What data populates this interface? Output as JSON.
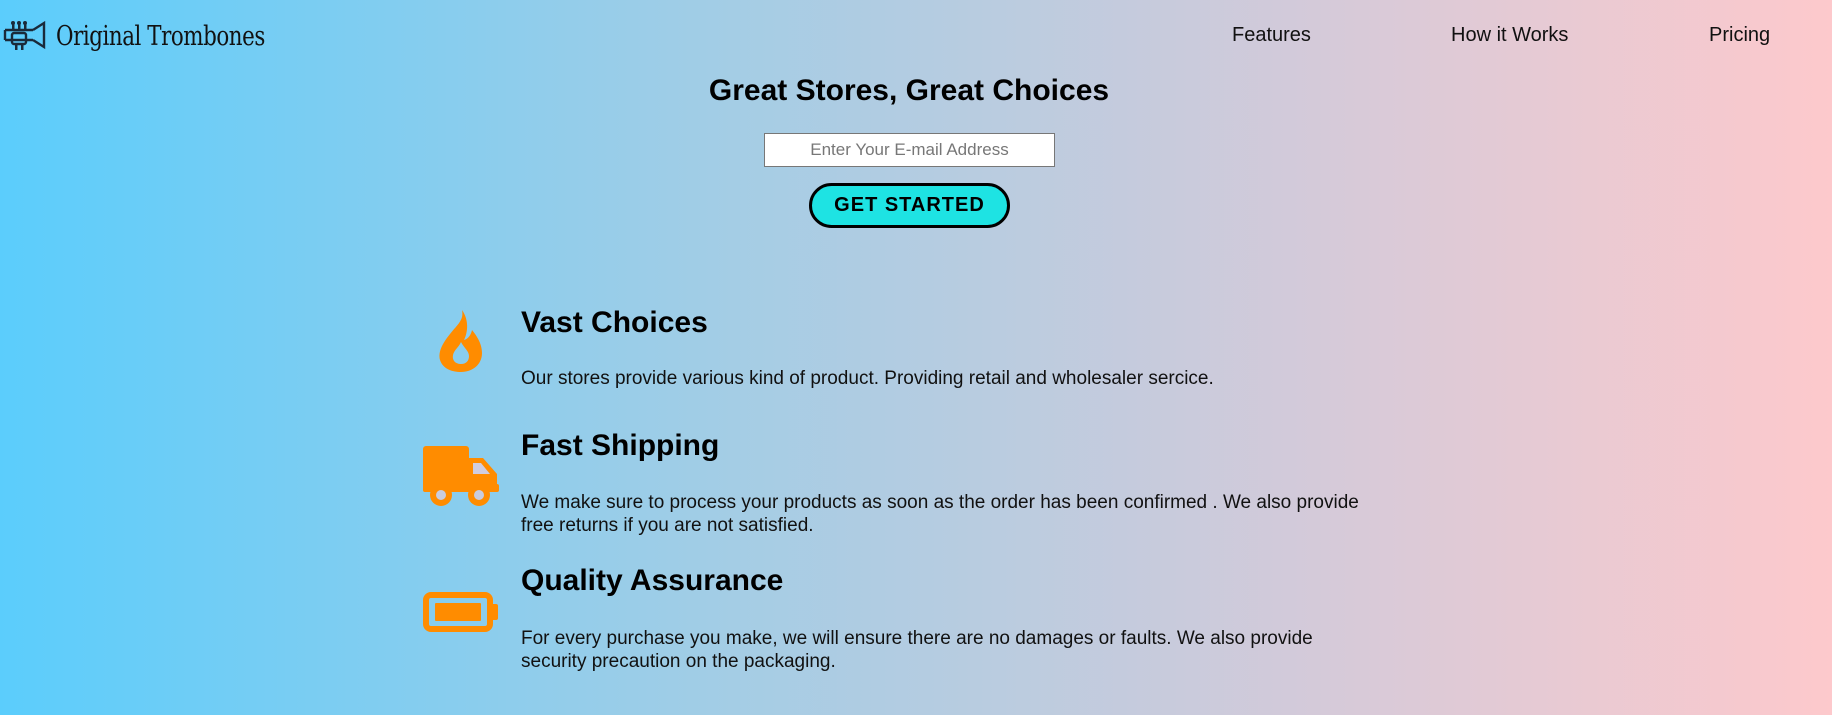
{
  "header": {
    "logo_text": "Original Trombones",
    "logo_icon": "trombone-icon",
    "nav": [
      {
        "label": "Features"
      },
      {
        "label": "How it Works"
      },
      {
        "label": "Pricing"
      }
    ]
  },
  "hero": {
    "title": "Great Stores, Great Choices",
    "email_placeholder": "Enter Your E-mail Address",
    "email_value": "",
    "cta_label": "GET STARTED"
  },
  "features": [
    {
      "icon": "fire-icon",
      "title": "Vast Choices",
      "description": "Our stores provide various kind of product. Providing retail and wholesaler sercice."
    },
    {
      "icon": "truck-icon",
      "title": "Fast Shipping",
      "description": "We make sure to process your products as soon as the order has been confirmed . We also provide free returns if you are not satisfied."
    },
    {
      "icon": "battery-icon",
      "title": "Quality Assurance",
      "description": "For every purchase you make, we will ensure there are no damages or faults. We also provide security precaution on the packaging."
    }
  ],
  "colors": {
    "icon_accent": "#ff8c00",
    "cta_background": "#1ee3e3",
    "gradient_left": "#5bcdfc",
    "gradient_right": "#fdc9cc"
  }
}
